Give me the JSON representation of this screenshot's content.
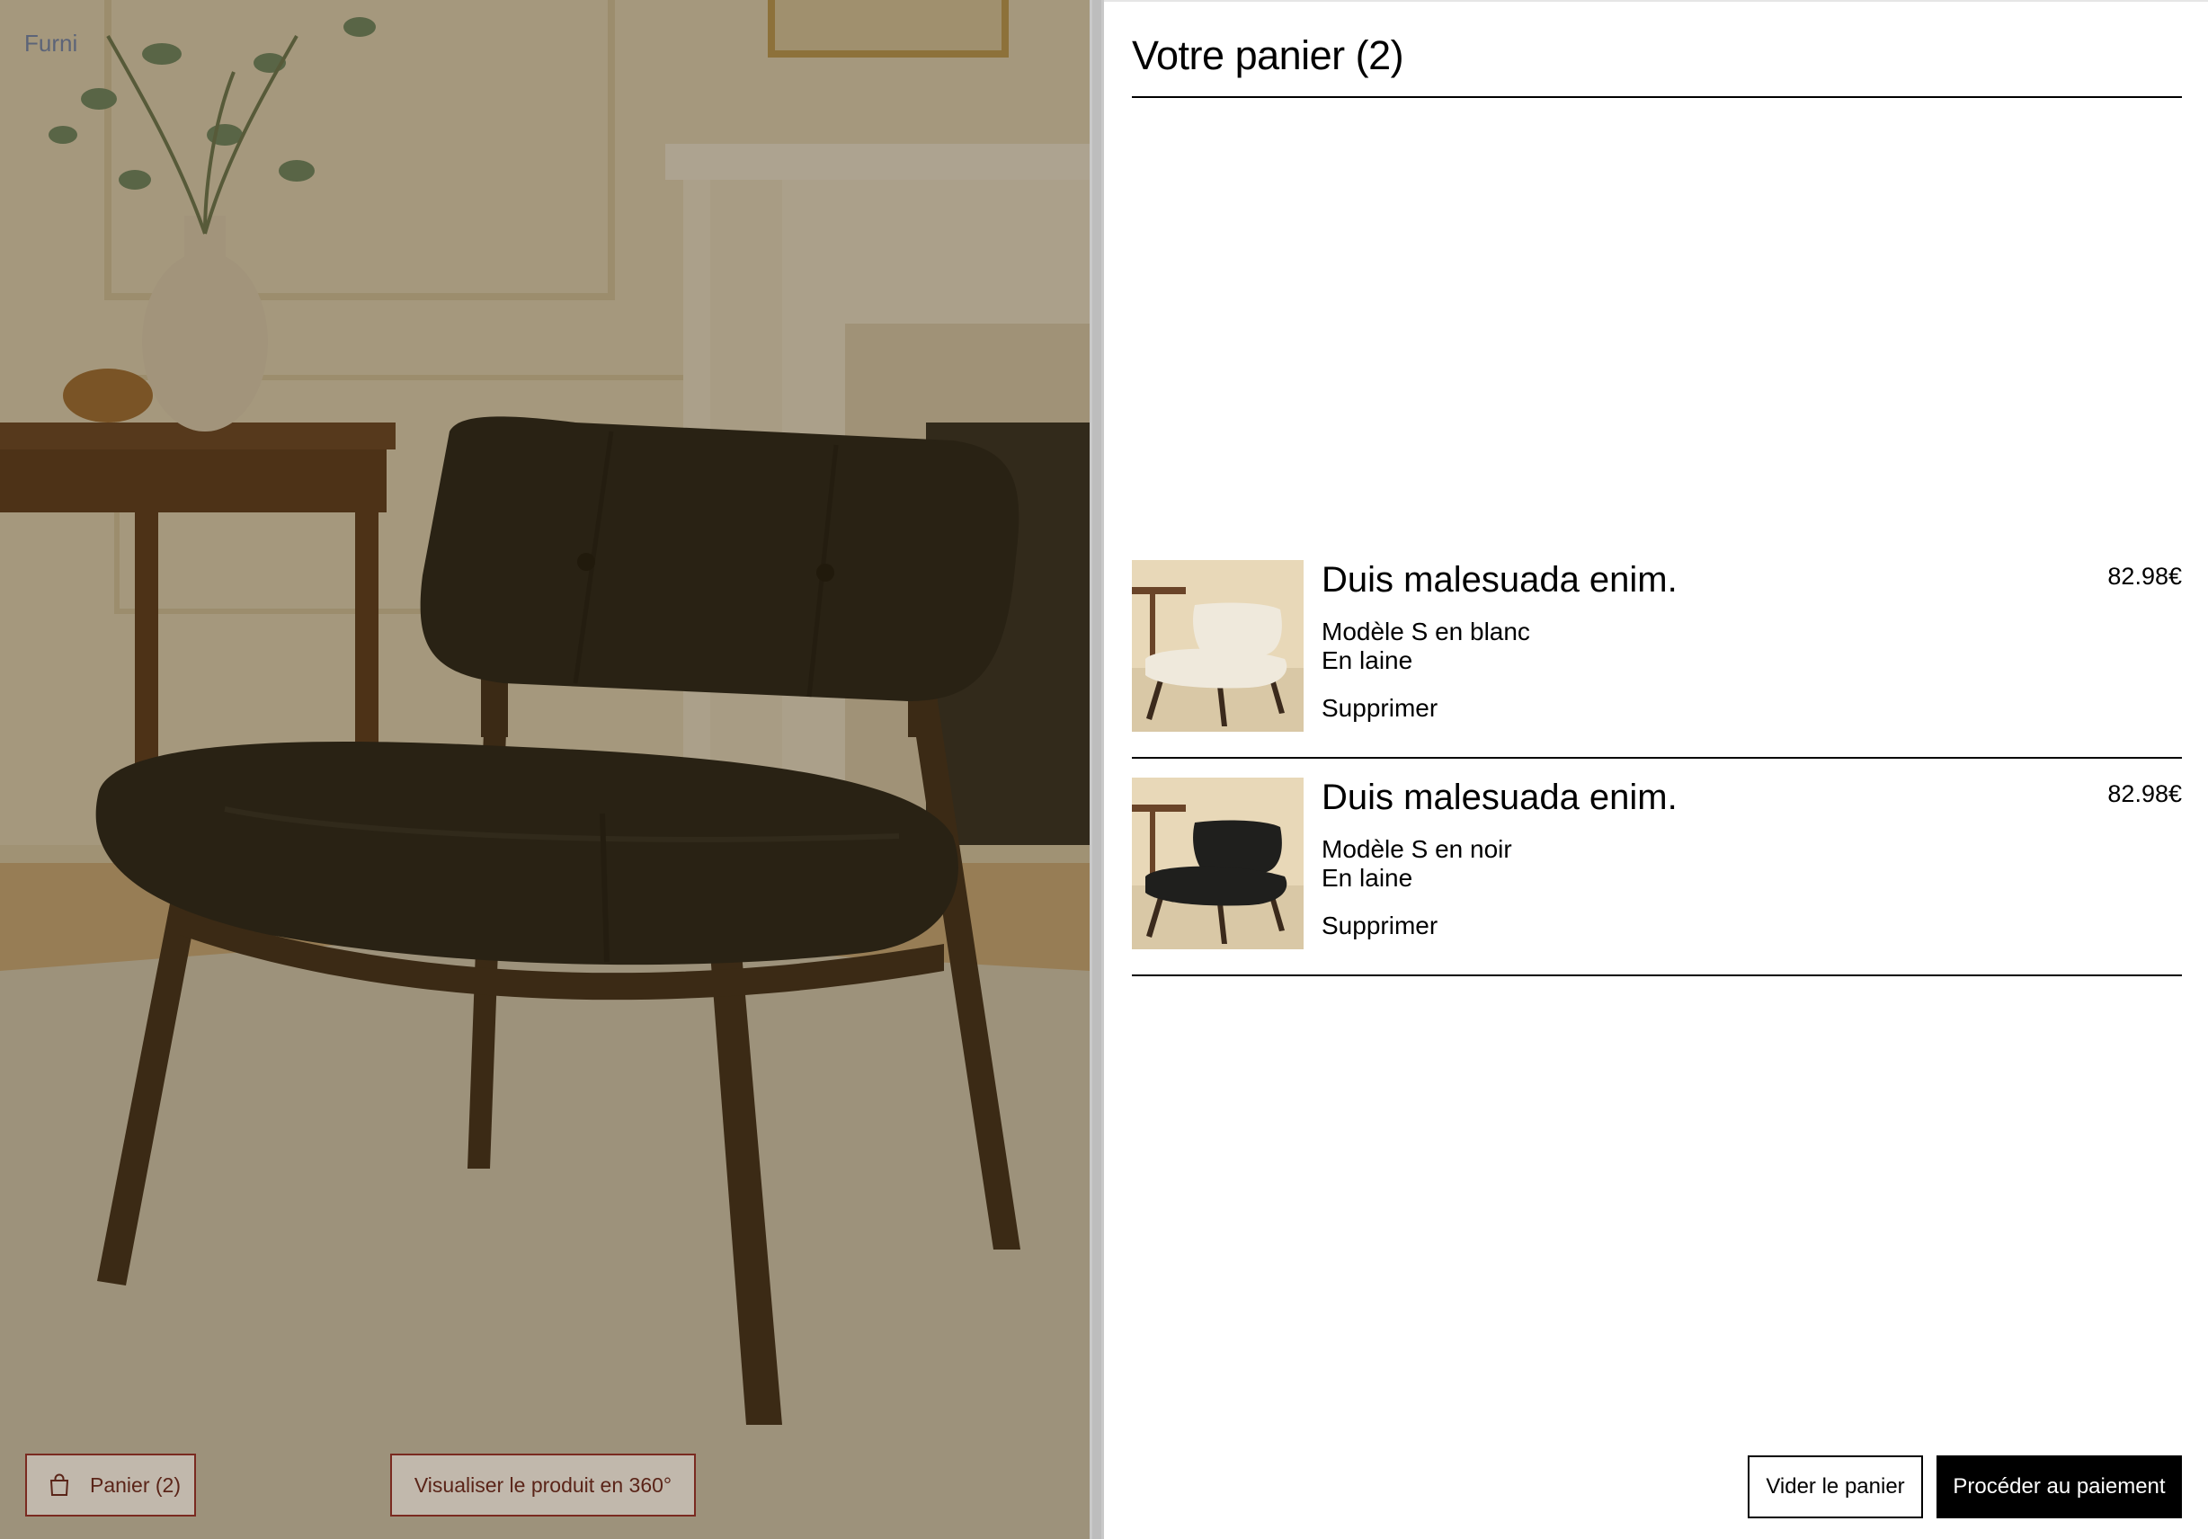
{
  "hero": {
    "brand": "Furni",
    "cart_button_label": "Panier (2)",
    "view360_label": "Visualiser le produit en 360°"
  },
  "cart": {
    "title": "Votre panier (2)",
    "items": [
      {
        "name": "Duis malesuada enim.",
        "variant": "Modèle S en blanc",
        "material": "En laine",
        "remove_label": "Supprimer",
        "price": "82.98€",
        "fabric_color": "#efe9dc"
      },
      {
        "name": "Duis malesuada enim.",
        "variant": "Modèle S en noir",
        "material": "En laine",
        "remove_label": "Supprimer",
        "price": "82.98€",
        "fabric_color": "#1f1f1d"
      }
    ],
    "clear_label": "Vider le panier",
    "checkout_label": "Procéder au paiement"
  },
  "colors": {
    "accent": "#000000",
    "hero_button_border": "#7a2a20",
    "chair_fabric": "#1c1c1a",
    "wood": "#3b2a1c"
  }
}
